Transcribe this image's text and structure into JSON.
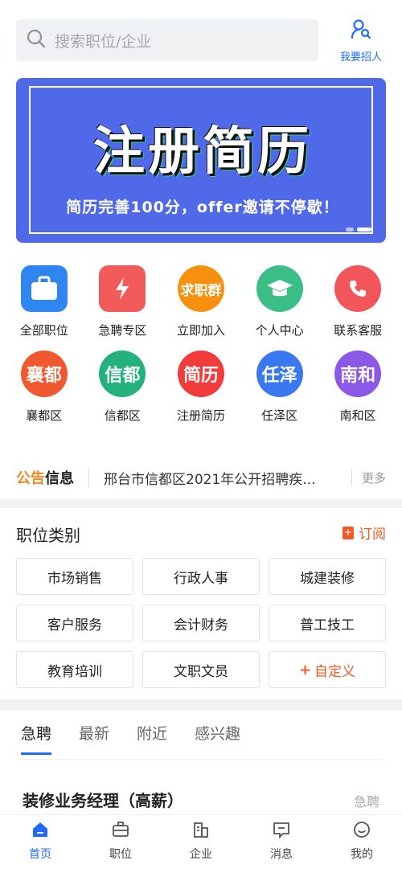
{
  "search": {
    "placeholder": "搜索职位/企业"
  },
  "recruit": {
    "label": "我要招人"
  },
  "banner": {
    "title": "注册简历",
    "subtitle": "简历完善100分，offer邀请不停歇！"
  },
  "quick_menu": [
    {
      "label": "全部职位",
      "icon": "briefcase-icon",
      "color": "#2f86f0",
      "text": ""
    },
    {
      "label": "急聘专区",
      "icon": "lightning-doc-icon",
      "color": "#f35a5a",
      "text": ""
    },
    {
      "label": "立即加入",
      "icon": "job-group-icon",
      "color": "#f7900f",
      "text": "求职群"
    },
    {
      "label": "个人中心",
      "icon": "graduation-cap-icon",
      "color": "#3cbf86",
      "text": ""
    },
    {
      "label": "联系客服",
      "icon": "phone-bubble-icon",
      "color": "#f2565b",
      "text": ""
    },
    {
      "label": "襄都区",
      "icon": "district-icon",
      "color": "#f0592e",
      "text": "襄都"
    },
    {
      "label": "信都区",
      "icon": "district-icon",
      "color": "#23b27e",
      "text": "信都"
    },
    {
      "label": "注册简历",
      "icon": "resume-icon",
      "color": "#f23b3b",
      "text": "简历"
    },
    {
      "label": "任泽区",
      "icon": "district-icon",
      "color": "#3a78f0",
      "text": "任泽"
    },
    {
      "label": "南和区",
      "icon": "district-icon",
      "color": "#8b58e8",
      "text": "南和"
    }
  ],
  "notice": {
    "tag_a": "公告",
    "tag_b": "信息",
    "text": "邢台市信都区2021年公开招聘疾...",
    "more": "更多"
  },
  "categories": {
    "title": "职位类别",
    "subscribe": "订阅",
    "items": [
      "市场销售",
      "行政人事",
      "城建装修",
      "客户服务",
      "会计财务",
      "普工技工",
      "教育培训",
      "文职文员"
    ],
    "custom": "自定义"
  },
  "jobs": {
    "tabs": [
      "急聘",
      "最新",
      "附近",
      "感兴趣"
    ],
    "first": {
      "title": "装修业务经理（高薪）",
      "badge": "急聘"
    }
  },
  "nav": [
    {
      "label": "首页",
      "icon": "home-icon"
    },
    {
      "label": "职位",
      "icon": "briefcase-icon"
    },
    {
      "label": "企业",
      "icon": "building-icon"
    },
    {
      "label": "消息",
      "icon": "message-icon"
    },
    {
      "label": "我的",
      "icon": "profile-icon"
    }
  ],
  "colors": {
    "accent": "#1f6bff",
    "orange": "#f05a24",
    "banner": "#4f69e8"
  }
}
